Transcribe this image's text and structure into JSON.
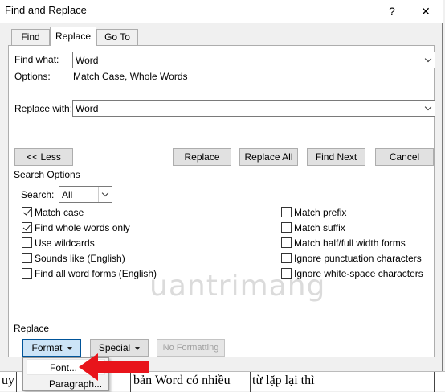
{
  "window": {
    "title": "Find and Replace",
    "help": "?",
    "close": "✕"
  },
  "tabs": [
    {
      "label": "Find",
      "active": false
    },
    {
      "label": "Replace",
      "active": true
    },
    {
      "label": "Go To",
      "active": false
    }
  ],
  "find": {
    "label": "Find what:",
    "value": "Word",
    "options_label": "Options:",
    "options_value": "Match Case, Whole Words"
  },
  "replace": {
    "label": "Replace with:",
    "value": "Word"
  },
  "buttons": {
    "less": "<< Less",
    "replace": "Replace",
    "replace_all": "Replace All",
    "find_next": "Find Next",
    "cancel": "Cancel"
  },
  "search_options": {
    "heading": "Search Options",
    "search_label": "Search:",
    "search_value": "All",
    "left": [
      {
        "label": "Match case",
        "checked": true
      },
      {
        "label": "Find whole words only",
        "checked": true
      },
      {
        "label": "Use wildcards",
        "checked": false
      },
      {
        "label": "Sounds like (English)",
        "checked": false
      },
      {
        "label": "Find all word forms (English)",
        "checked": false
      }
    ],
    "right": [
      {
        "label": "Match prefix",
        "checked": false
      },
      {
        "label": "Match suffix",
        "checked": false
      },
      {
        "label": "Match half/full width forms",
        "checked": false
      },
      {
        "label": "Ignore punctuation characters",
        "checked": false
      },
      {
        "label": "Ignore white-space characters",
        "checked": false
      }
    ]
  },
  "replace_section": {
    "heading": "Replace",
    "format": "Format",
    "special": "Special",
    "no_formatting": "No Formatting"
  },
  "format_menu": [
    {
      "label": "Font..."
    },
    {
      "label": "Paragraph..."
    }
  ],
  "document": {
    "left_text": "uy",
    "mid_text": "bản Word có nhiều",
    "right_text": "từ lặp lại thì"
  },
  "watermark": "uantrimang",
  "colors": {
    "arrow": "#e8141b",
    "accent": "#005499"
  }
}
